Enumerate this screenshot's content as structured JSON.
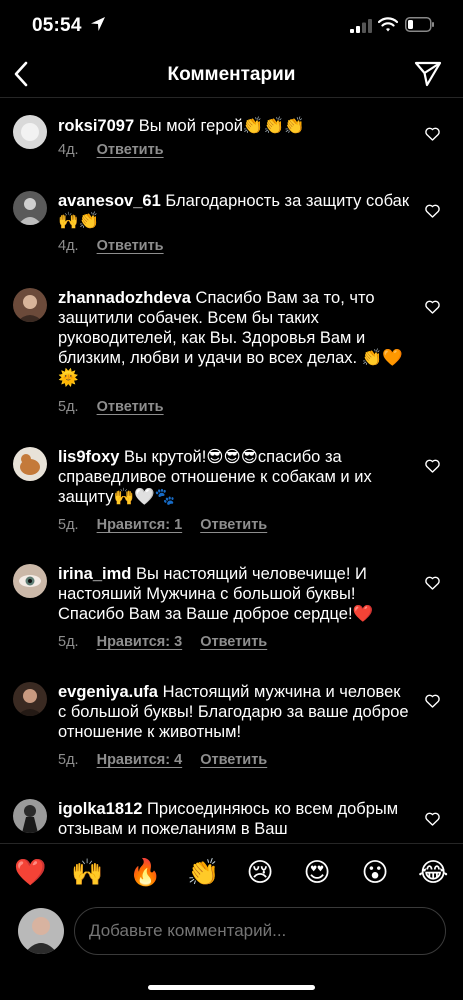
{
  "status_bar": {
    "time": "05:54"
  },
  "nav": {
    "title": "Комментарии"
  },
  "comments": [
    {
      "user": "roksi7097",
      "text": "Вы мой герой👏👏👏",
      "age": "4д.",
      "likes": "",
      "reply": "Ответить"
    },
    {
      "user": "avanesov_61",
      "text": "Благодарность за защиту собак 🙌👏",
      "age": "4д.",
      "likes": "",
      "reply": "Ответить"
    },
    {
      "user": "zhannadozhdeva",
      "text": "Спасибо Вам за то, что защитили собачек. Всем бы таких руководителей, как Вы. Здоровья Вам и близким, любви и удачи во всех делах. 👏🧡🌞",
      "age": "5д.",
      "likes": "",
      "reply": "Ответить"
    },
    {
      "user": "lis9foxy",
      "text": "Вы крутой!😎😎😎спасибо за справедливое отношение к собакам и их защиту🙌🤍🐾",
      "age": "5д.",
      "likes": "Нравится: 1",
      "reply": "Ответить"
    },
    {
      "user": "irina_imd",
      "text": "Вы настоящий человечище! И настояший Мужчина с большой буквы! Спасибо Вам за Ваше доброе сердце!❤️",
      "age": "5д.",
      "likes": "Нравится: 3",
      "reply": "Ответить"
    },
    {
      "user": "evgeniya.ufa",
      "text": "Настоящий мужчина и человек с большой буквы! Благодарю за ваше доброе отношение к животным!",
      "age": "5д.",
      "likes": "Нравится: 4",
      "reply": "Ответить"
    },
    {
      "user": "igolka1812",
      "text": "Присоединяюсь ко всем добрым отзывам и пожеланиям в Ваш",
      "age": "",
      "likes": "",
      "reply": ""
    }
  ],
  "reactions": [
    "❤️",
    "🙌",
    "🔥",
    "👏",
    "😢",
    "😍",
    "😮",
    "😂"
  ],
  "composer": {
    "placeholder": "Добавьте комментарий..."
  },
  "colors": {
    "background": "#000000",
    "meta_text": "#8e8e8e",
    "divider": "#262626"
  }
}
